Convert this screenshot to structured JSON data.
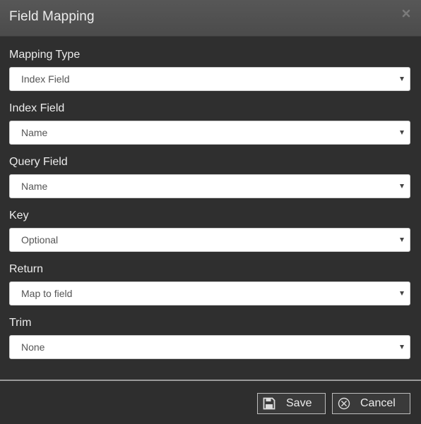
{
  "dialog": {
    "title": "Field Mapping",
    "close_icon": "close-icon"
  },
  "fields": [
    {
      "label": "Mapping Type",
      "value": "Index Field"
    },
    {
      "label": "Index Field",
      "value": "Name"
    },
    {
      "label": "Query Field",
      "value": "Name"
    },
    {
      "label": "Key",
      "value": "Optional"
    },
    {
      "label": "Return",
      "value": "Map to field"
    },
    {
      "label": "Trim",
      "value": "None"
    }
  ],
  "footer": {
    "save_label": "Save",
    "save_icon": "floppy-disk-icon",
    "cancel_label": "Cancel",
    "cancel_icon": "circle-x-icon"
  },
  "colors": {
    "titlebar": "#575757",
    "background": "#2e2e2e",
    "text": "#ececec",
    "select_bg": "#ffffff",
    "select_text": "#555555"
  }
}
